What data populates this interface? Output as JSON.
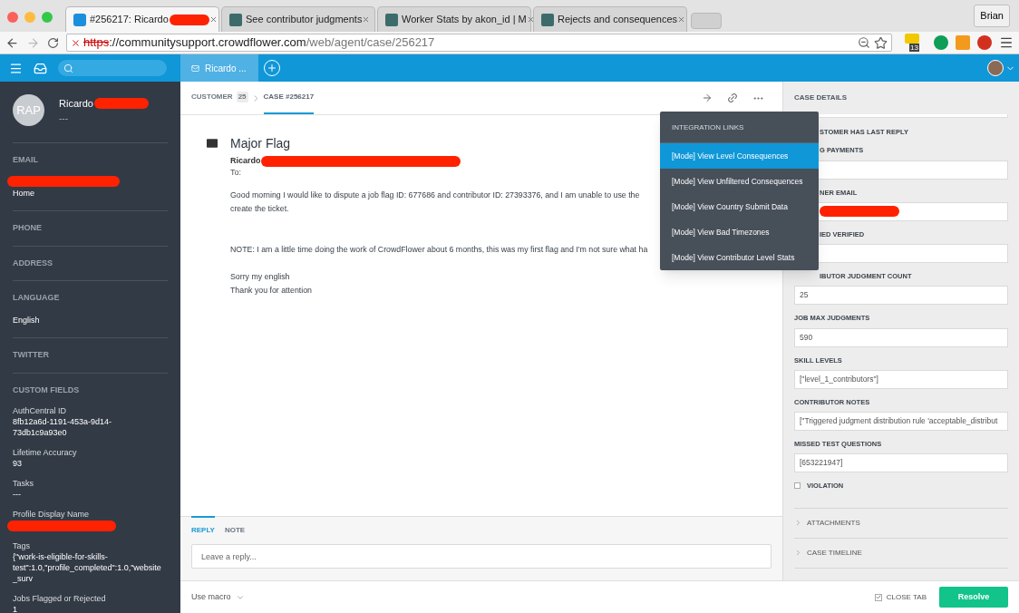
{
  "browser": {
    "tabs": [
      {
        "title": "#256217: Ricardo",
        "selected": true,
        "kind": "desk",
        "redacted": true
      },
      {
        "title": "See contributor judgments",
        "selected": false,
        "kind": "mode",
        "redacted": false
      },
      {
        "title": "Worker Stats by akon_id | M",
        "selected": false,
        "kind": "mode",
        "redacted": false
      },
      {
        "title": "Rejects and consequences",
        "selected": false,
        "kind": "mode",
        "redacted": false
      }
    ],
    "profile": "Brian",
    "url_scheme": "https",
    "url_host": "://communitysupport.crowdflower.com",
    "url_path": "/web/agent/case/256217",
    "extension_badge": "13"
  },
  "app_bar": {
    "open_tab": {
      "title": "Ricardo ...",
      "selected": true
    }
  },
  "customer": {
    "initials": "RAP",
    "name": "Ricardo",
    "subtitle": "---",
    "sections": [
      {
        "label": "EMAIL",
        "redacted": true,
        "value": "Home"
      },
      {
        "label": "PHONE",
        "redacted": false
      },
      {
        "label": "ADDRESS",
        "redacted": false
      },
      {
        "label": "LANGUAGE",
        "redacted": false,
        "value": "English"
      },
      {
        "label": "TWITTER",
        "redacted": false
      }
    ],
    "custom_title": "CUSTOM FIELDS",
    "custom_fields": [
      {
        "label": "AuthCentral ID",
        "value": "8fb12a6d-1191-453a-9d14-73db1c9a93e0",
        "redacted": false
      },
      {
        "label": "Lifetime Accuracy",
        "value": "93",
        "redacted": false
      },
      {
        "label": "Tasks",
        "value": "---",
        "redacted": false
      },
      {
        "label": "Profile Display Name",
        "redacted": true
      },
      {
        "label": "Tags",
        "value": "{\"work-is-eligible-for-skills-test\":1.0,\"profile_completed\":1.0,\"website_surv",
        "redacted": false
      },
      {
        "label": "Jobs Flagged or Rejected",
        "value": "1",
        "redacted": false
      }
    ]
  },
  "breadcrumb": [
    {
      "label": "CUSTOMER",
      "count": "25",
      "selected": false
    },
    {
      "label": "CASE #256217",
      "selected": true
    }
  ],
  "message": {
    "title": "Major Flag",
    "from": "Ricardo",
    "from_redacted": true,
    "to": "To:",
    "lines": [
      {
        "kind": "text",
        "text": "Good morning I would like to dispute a job flag ID: 677686 and contributor ID: 27393376, and I am unable to use the"
      },
      {
        "kind": "text",
        "text": "create the ticket."
      },
      {
        "kind": "blank"
      },
      {
        "kind": "blank"
      },
      {
        "kind": "text",
        "text": "NOTE: I am a little time doing the work of CrowdFlower about 6 months, this was my first flag and I'm not sure what ha"
      },
      {
        "kind": "blank"
      },
      {
        "kind": "text",
        "text": "Sorry my english"
      },
      {
        "kind": "text",
        "text": "Thank you for attention"
      }
    ]
  },
  "integration_menu": {
    "title": "INTEGRATION LINKS",
    "items": [
      {
        "label": "[Mode] View Level Consequences",
        "selected": true
      },
      {
        "label": "[Mode] View Unfiltered Consequences",
        "selected": false
      },
      {
        "label": "[Mode] View Country Submit Data",
        "selected": false
      },
      {
        "label": "[Mode] View Bad Timezones",
        "selected": false
      },
      {
        "label": "[Mode] View Contributor Level Stats",
        "selected": false
      }
    ]
  },
  "case_details": {
    "title": "CASE DETAILS",
    "fields": [
      {
        "kind": "label",
        "label": "STOMER HAS LAST REPLY",
        "under_menu": true
      },
      {
        "kind": "text",
        "label": "G PAYMENTS",
        "under_menu": true
      },
      {
        "kind": "text",
        "label": "NER EMAIL",
        "under_menu": true,
        "redacted": true
      },
      {
        "kind": "text",
        "label": "IED VERIFIED",
        "under_menu": true
      },
      {
        "kind": "text",
        "label": "IBUTOR JUDGMENT COUNT",
        "under_menu": true,
        "value": "25"
      },
      {
        "kind": "text",
        "label": "JOB MAX JUDGMENTS",
        "value": "590"
      },
      {
        "kind": "text",
        "label": "SKILL LEVELS",
        "value": "[\"level_1_contributors\"]"
      },
      {
        "kind": "text",
        "label": "CONTRIBUTOR NOTES",
        "value": "[\"Triggered judgment distribution rule 'acceptable_distribut"
      },
      {
        "kind": "text",
        "label": "MISSED TEST QUESTIONS",
        "value": "[653221947]"
      },
      {
        "kind": "checkbox",
        "label": "VIOLATION",
        "checked": false
      }
    ],
    "sections": [
      {
        "label": "ATTACHMENTS",
        "expanded": false
      },
      {
        "label": "CASE TIMELINE",
        "expanded": false
      }
    ]
  },
  "reply": {
    "tabs": [
      {
        "label": "REPLY",
        "selected": true
      },
      {
        "label": "NOTE",
        "selected": false
      }
    ],
    "placeholder": "Leave a reply..."
  },
  "footer": {
    "macro": "Use macro",
    "close_tab": {
      "label": "CLOSE TAB",
      "checked": true
    },
    "resolve": "Resolve"
  }
}
